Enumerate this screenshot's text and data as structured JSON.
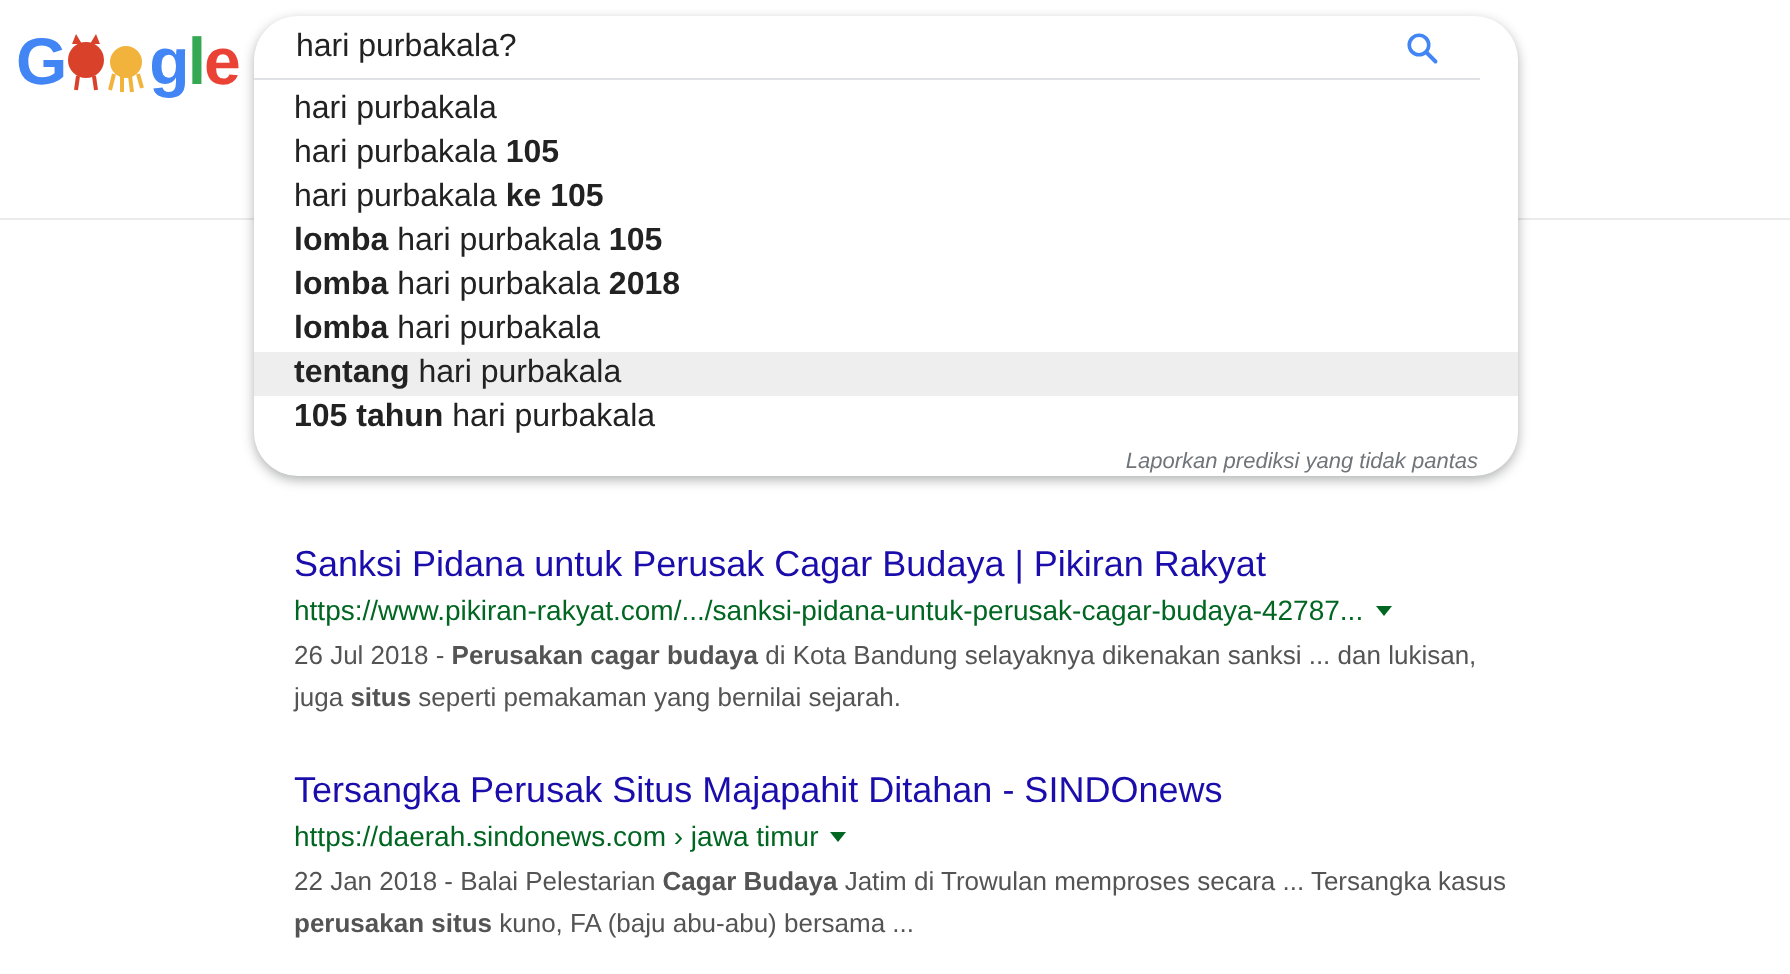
{
  "logo": {
    "before": "G",
    "after": "gle"
  },
  "search": {
    "value": "hari purbakala?"
  },
  "suggestions": [
    {
      "text": "hari purbakala",
      "selected": false
    },
    {
      "text": "hari purbakala **105**",
      "selected": false
    },
    {
      "text": "hari purbakala **ke 105**",
      "selected": false
    },
    {
      "text": "**lomba** hari purbakala **105**",
      "selected": false
    },
    {
      "text": "**lomba** hari purbakala **2018**",
      "selected": false
    },
    {
      "text": "**lomba** hari purbakala",
      "selected": false
    },
    {
      "text": "**tentang** hari purbakala",
      "selected": true
    },
    {
      "text": "**105 tahun** hari purbakala",
      "selected": false
    }
  ],
  "report_link": "Laporkan prediksi yang tidak pantas",
  "results": [
    {
      "title": "Sanksi Pidana untuk Perusak Cagar Budaya | Pikiran Rakyat",
      "url": "https://www.pikiran-rakyat.com/.../sanksi-pidana-untuk-perusak-cagar-budaya-42787...",
      "date": "26 Jul 2018 - ",
      "snippet": "**Perusakan cagar budaya** di Kota Bandung selayaknya dikenakan sanksi ... dan lukisan, juga **situs** seperti pemakaman yang bernilai sejarah."
    },
    {
      "title": "Tersangka Perusak Situs Majapahit Ditahan - SINDOnews",
      "url": "https://daerah.sindonews.com › jawa timur",
      "date": "22 Jan 2018 - ",
      "snippet": "Balai Pelestarian **Cagar Budaya** Jatim di Trowulan memproses secara ... Tersangka kasus **perusakan situs** kuno, FA (baju abu-abu) bersama ..."
    }
  ]
}
